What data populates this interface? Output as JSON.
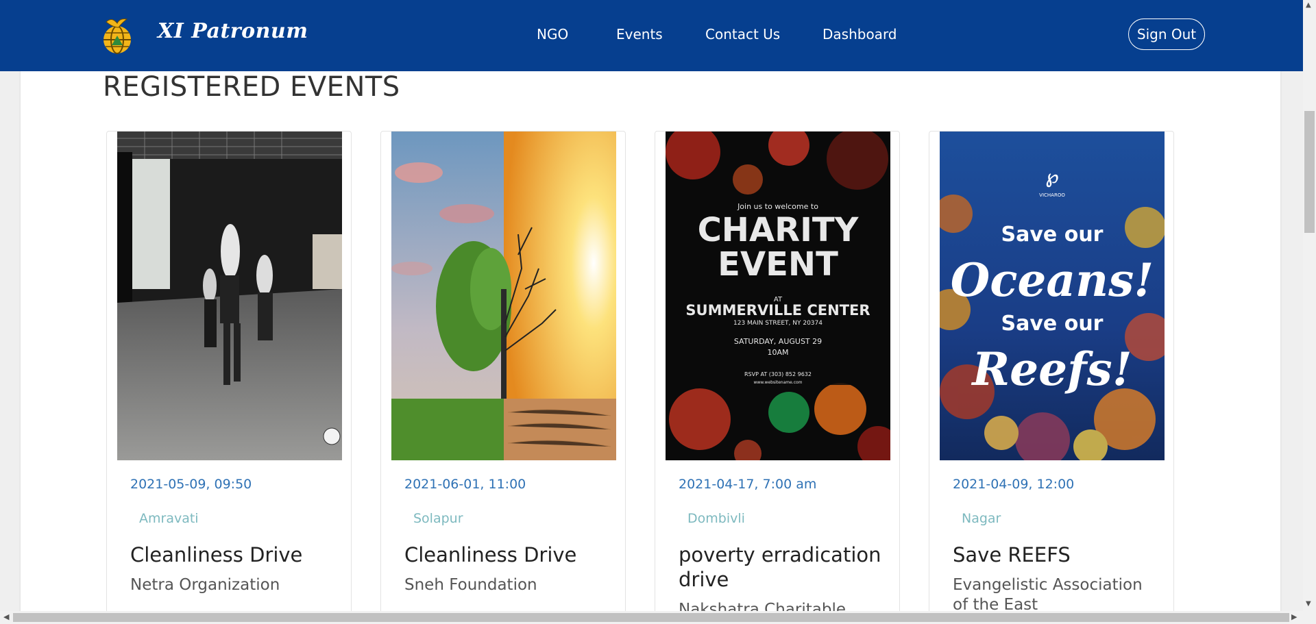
{
  "brand": {
    "name": "XI Patronum",
    "logo_icon": "globe-dove-logo"
  },
  "nav": {
    "links": [
      "NGO",
      "Events",
      "Contact Us",
      "Dashboard"
    ],
    "sign_out": "Sign Out"
  },
  "page": {
    "heading": "REGISTERED EVENTS"
  },
  "events": [
    {
      "datetime": "2021-05-09, 09:50",
      "city": "Amravati",
      "title": "Cleanliness Drive",
      "organization": "Netra Organization",
      "image": "dancers-studio-photo"
    },
    {
      "datetime": "2021-06-01, 11:00",
      "city": "Solapur",
      "title": "Cleanliness Drive",
      "organization": "Sneh Foundation",
      "image": "green-tree-vs-dead-tree-photo"
    },
    {
      "datetime": "2021-04-17, 7:00 am",
      "city": "Dombivli",
      "title": "poverty erradication drive",
      "organization": "Nakshatra Charitable",
      "image": "charity-event-poster",
      "poster": {
        "intro": "Join us to welcome to",
        "line1": "CHARITY",
        "line2": "EVENT",
        "at": "AT",
        "venue": "SUMMERVILLE CENTER",
        "address": "123 MAIN STREET, NY 20374",
        "date": "SATURDAY, AUGUST 29",
        "time": "10AM",
        "rsvp": "RSVP AT (303) 852 9632",
        "web": "www.websitename.com"
      }
    },
    {
      "datetime": "2021-04-09, 12:00",
      "city": "Nagar",
      "title": "Save REEFS",
      "organization": "Evangelistic Association of the East",
      "image": "save-oceans-reef-poster",
      "poster": {
        "brand": "VICHAROO",
        "l1": "Save our",
        "l2": "Oceans!",
        "l3": "Save our",
        "l4": "Reefs!"
      }
    }
  ],
  "colors": {
    "navbar": "#063f8f",
    "date": "#2f72b5",
    "city": "#7db9bf"
  }
}
